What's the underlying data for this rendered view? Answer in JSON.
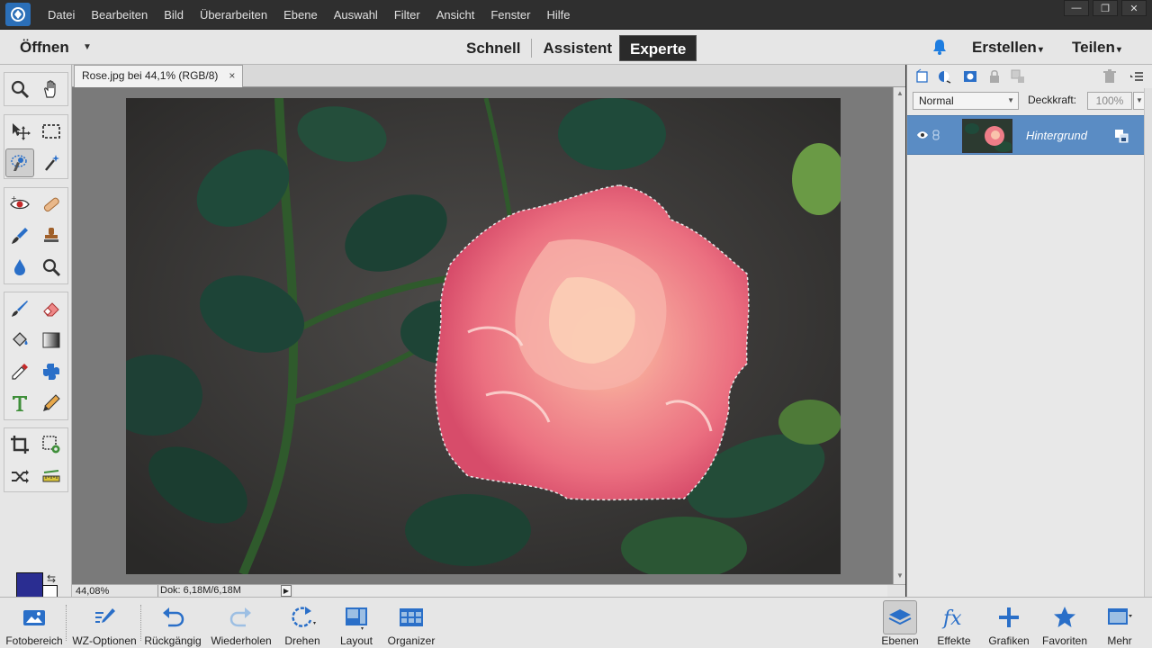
{
  "menu": {
    "items": [
      "Datei",
      "Bearbeiten",
      "Bild",
      "Überarbeiten",
      "Ebene",
      "Auswahl",
      "Filter",
      "Ansicht",
      "Fenster",
      "Hilfe"
    ]
  },
  "window_controls": {
    "minimize": "—",
    "restore": "❐",
    "close": "✕"
  },
  "modebar": {
    "open_label": "Öffnen",
    "tabs": [
      "Schnell",
      "Assistent",
      "Experte"
    ],
    "active_tab": "Experte",
    "create_label": "Erstellen",
    "share_label": "Teilen"
  },
  "document": {
    "tab_title": "Rose.jpg bei 44,1% (RGB/8)",
    "close_glyph": "×",
    "zoom": "44,08%",
    "doc_info": "Dok: 6,18M/6,18M"
  },
  "colors": {
    "foreground": "#2a2d91",
    "background": "#ffffff",
    "accent": "#5a8cc4"
  },
  "layers_panel": {
    "blend_mode": "Normal",
    "opacity_label": "Deckkraft:",
    "opacity_value": "100%",
    "layers": [
      {
        "name": "Hintergrund",
        "selected": true
      }
    ]
  },
  "tools": [
    "zoom-tool",
    "hand-tool",
    "move-tool",
    "rectangular-marquee-tool",
    "quick-selection-tool",
    "magic-wand-tool",
    "red-eye-tool",
    "healing-brush-tool",
    "smart-brush-tool",
    "clone-stamp-tool",
    "blur-tool",
    "sponge-tool",
    "brush-tool",
    "eraser-tool",
    "paint-bucket-tool",
    "gradient-tool",
    "eyedropper-tool",
    "custom-shape-tool",
    "type-tool",
    "pencil-tool",
    "crop-tool",
    "recompose-tool",
    "content-aware-move-tool",
    "straighten-tool"
  ],
  "taskbar": {
    "left": [
      "Fotobereich",
      "WZ-Optionen",
      "Rückgängig",
      "Wiederholen",
      "Drehen",
      "Layout",
      "Organizer"
    ],
    "right": [
      "Ebenen",
      "Effekte",
      "Grafiken",
      "Favoriten",
      "Mehr"
    ],
    "active": "Ebenen"
  }
}
